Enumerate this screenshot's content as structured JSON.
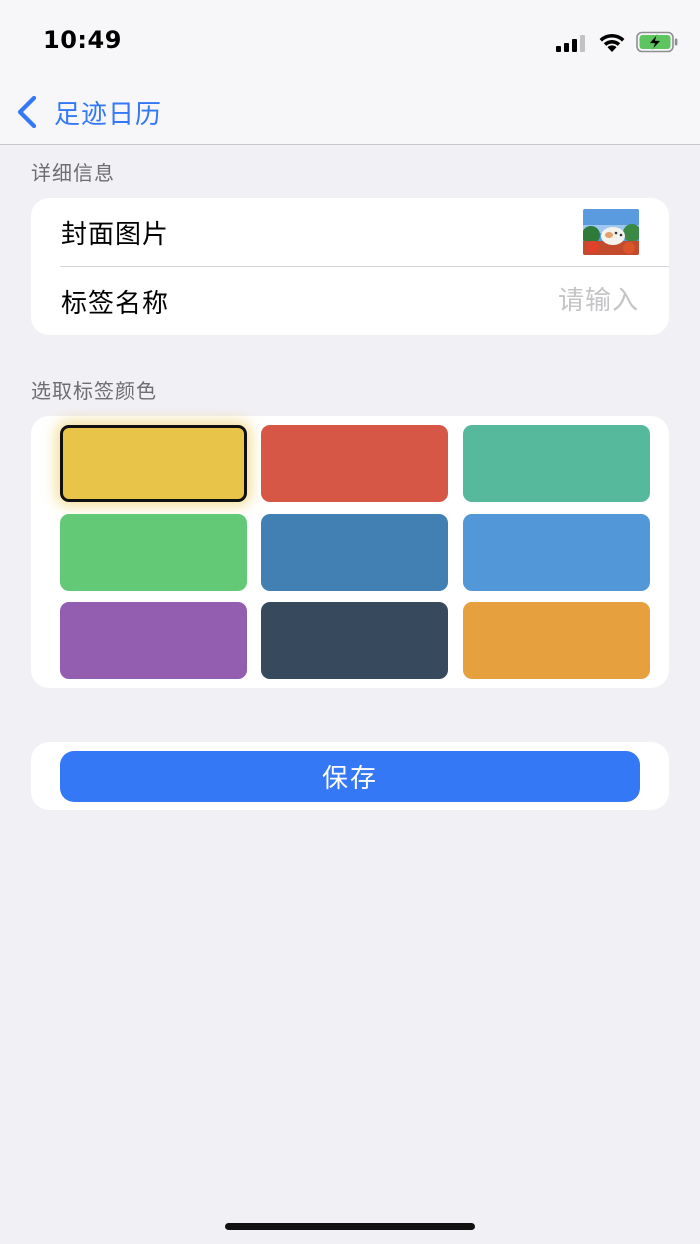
{
  "status_bar": {
    "time": "10:49"
  },
  "nav": {
    "back_label": "足迹日历"
  },
  "details": {
    "header": "详细信息",
    "cover_label": "封面图片",
    "name_label": "标签名称",
    "name_placeholder": "请输入",
    "name_value": ""
  },
  "colors": {
    "header": "选取标签颜色",
    "selected_index": 0,
    "swatches": [
      "#e8c548",
      "#d65745",
      "#56b99b",
      "#64c977",
      "#4280b3",
      "#5297d7",
      "#935db0",
      "#37495c",
      "#e6a03e"
    ]
  },
  "save": {
    "label": "保存"
  },
  "theme": {
    "accent": "#3478f6",
    "background": "#f1f0f5",
    "battery_fill": "#5cc55f"
  }
}
